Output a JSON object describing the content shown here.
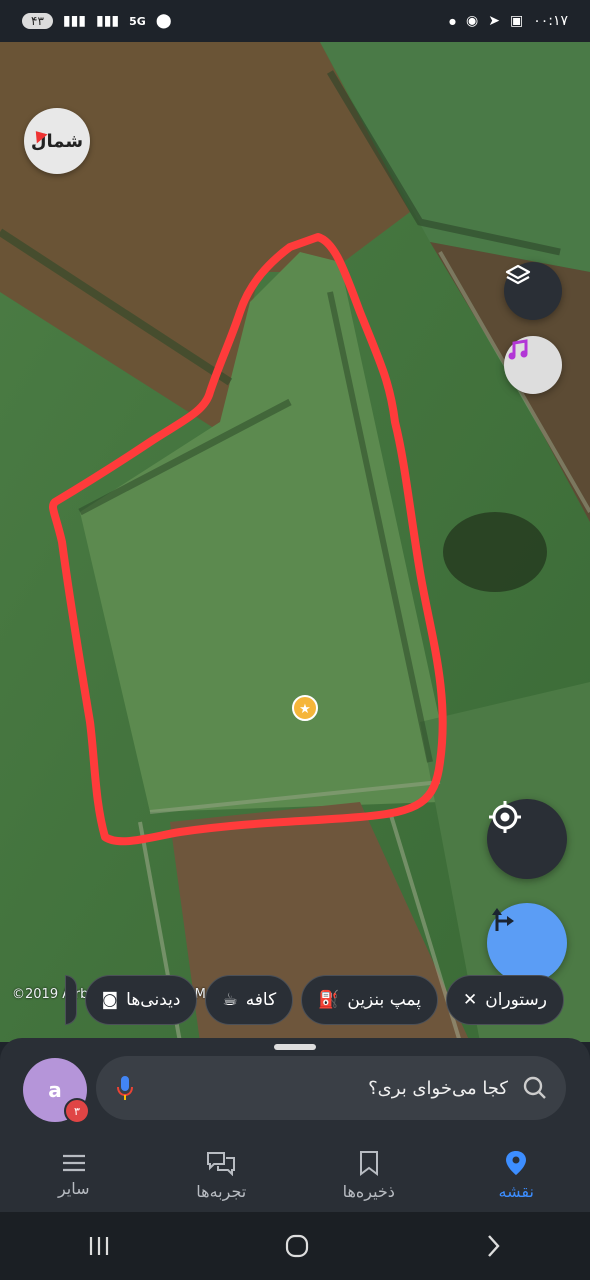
{
  "status_bar": {
    "time": "۰۰:۱۷",
    "battery": "۴۳",
    "network": "5G"
  },
  "map": {
    "north_label": "شمال",
    "attribution": "©2019 Airbus ©OpenStreetMap"
  },
  "chips": [
    {
      "label": "رستوران",
      "icon": "fork-knife-icon"
    },
    {
      "label": "پمپ بنزین",
      "icon": "fuel-pump-icon"
    },
    {
      "label": "کافه",
      "icon": "coffee-cup-icon"
    },
    {
      "label": "دیدنی‌ها",
      "icon": "camera-icon"
    }
  ],
  "search": {
    "placeholder": "کجا می‌خوای بری؟"
  },
  "profile": {
    "initial": "a",
    "badge_count": "۳"
  },
  "bottom_nav": [
    {
      "label": "نقشه",
      "icon": "map-pin-icon",
      "active": true
    },
    {
      "label": "ذخیره‌ها",
      "icon": "bookmark-icon",
      "active": false
    },
    {
      "label": "تجربه‌ها",
      "icon": "chat-bubbles-icon",
      "active": false
    },
    {
      "label": "سایر",
      "icon": "menu-icon",
      "active": false
    }
  ],
  "colors": {
    "accent": "#3d8eff",
    "route_button": "#5b9df5",
    "annotation": "#ff3b3b",
    "marker": "#f5b53a"
  }
}
